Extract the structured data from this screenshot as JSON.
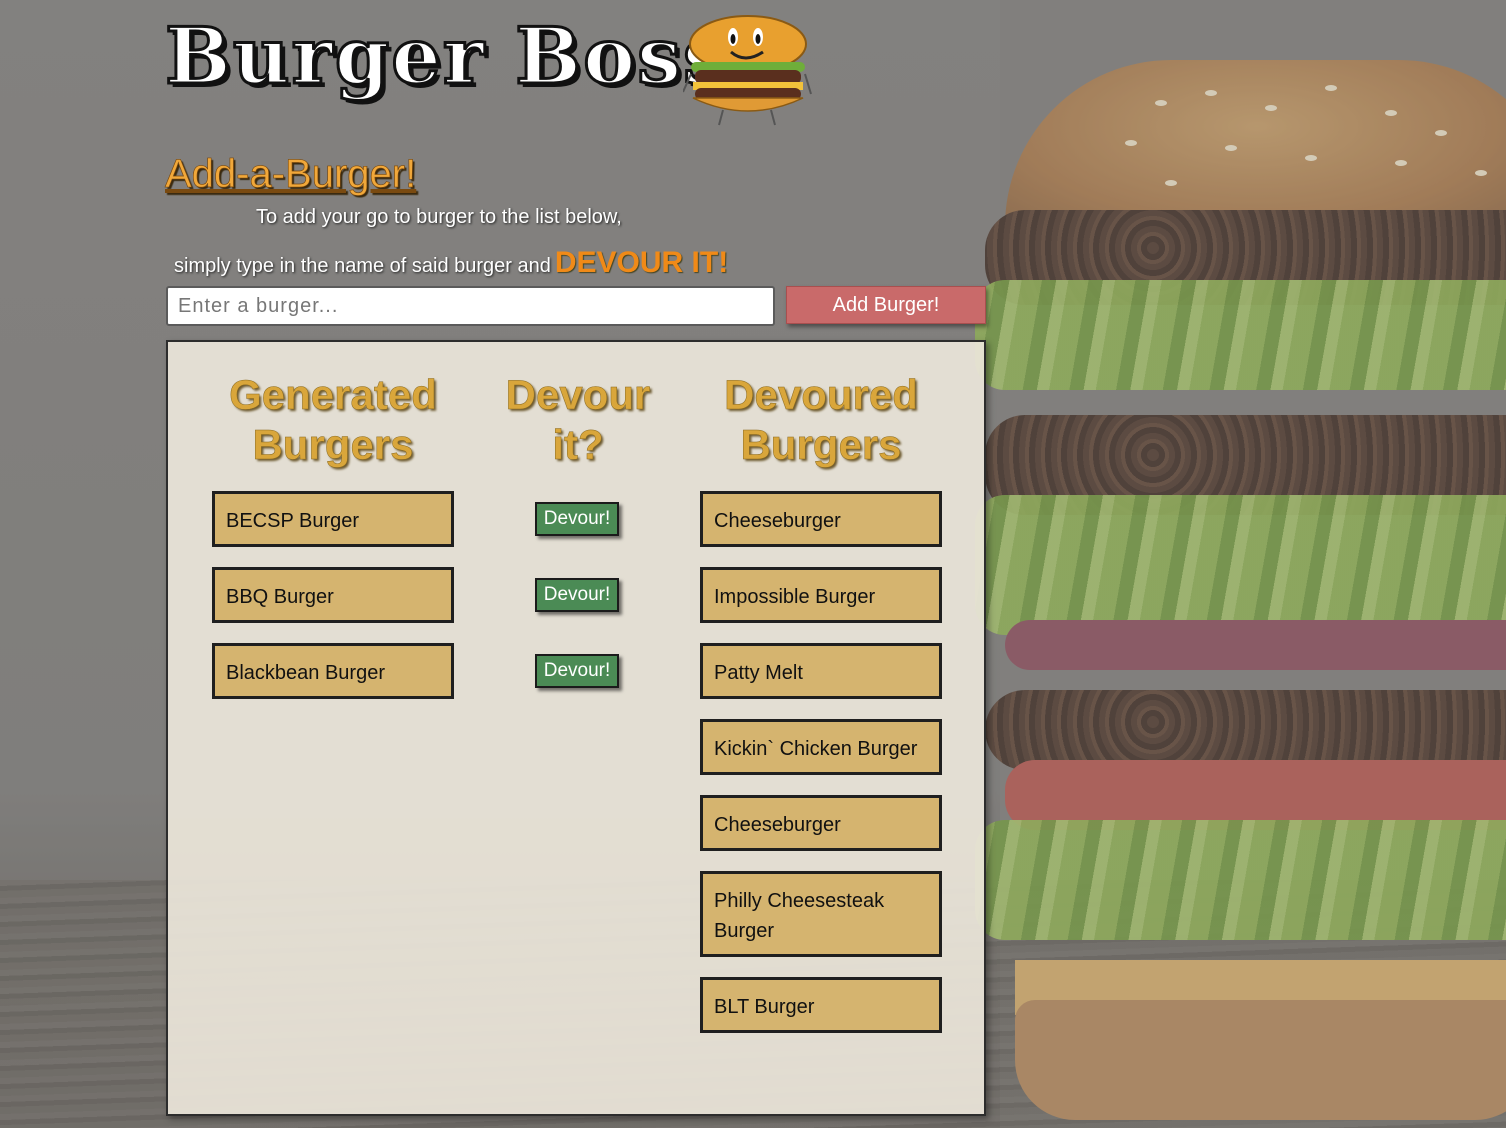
{
  "header": {
    "logo_text": "Burger Boss",
    "mascot_icon": "burger-mascot-icon"
  },
  "add_section": {
    "heading": "Add-a-Burger!",
    "intro_line1": "To add your go to burger to the list below,",
    "intro_line2": "simply type in the name of said burger and",
    "intro_highlight": "DEVOUR IT!",
    "input_placeholder": "Enter a burger...",
    "add_button_label": "Add Burger!"
  },
  "columns": {
    "generated_line1": "Generated",
    "generated_line2": "Burgers",
    "devour_line1": "Devour",
    "devour_line2": "it?",
    "devoured_line1": "Devoured",
    "devoured_line2": "Burgers"
  },
  "generated_burgers": [
    {
      "name": "BECSP Burger",
      "devour_label": "Devour!"
    },
    {
      "name": "BBQ Burger",
      "devour_label": "Devour!"
    },
    {
      "name": "Blackbean Burger",
      "devour_label": "Devour!"
    }
  ],
  "devoured_burgers": [
    "Cheeseburger",
    "Impossible Burger",
    "Patty Melt",
    "Kickin` Chicken Burger",
    "Cheeseburger",
    "Philly Cheesesteak Burger",
    "BLT Burger"
  ],
  "colors": {
    "accent_orange": "#f1a83a",
    "add_button": "#c96a6a",
    "devour_button": "#4b8b55",
    "item_fill": "#d5b46f"
  }
}
